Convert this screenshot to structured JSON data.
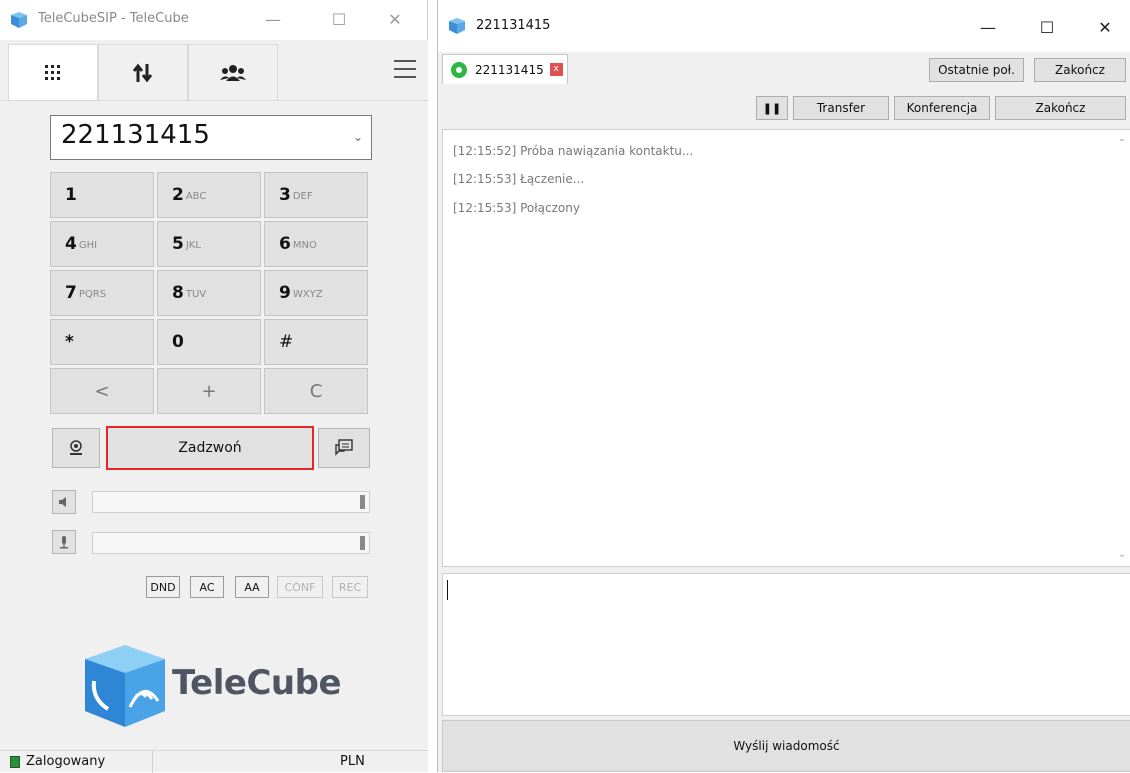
{
  "left_window": {
    "title": "TeleCubeSIP - TeleCube",
    "controls": {
      "minimize": "—",
      "maximize": "☐",
      "close": "✕"
    },
    "number": "221131415",
    "keypad": [
      {
        "digit": "1",
        "letters": ""
      },
      {
        "digit": "2",
        "letters": "ABC"
      },
      {
        "digit": "3",
        "letters": "DEF"
      },
      {
        "digit": "4",
        "letters": "GHI"
      },
      {
        "digit": "5",
        "letters": "JKL"
      },
      {
        "digit": "6",
        "letters": "MNO"
      },
      {
        "digit": "7",
        "letters": "PQRS"
      },
      {
        "digit": "8",
        "letters": "TUV"
      },
      {
        "digit": "9",
        "letters": "WXYZ"
      },
      {
        "digit": "*",
        "letters": ""
      },
      {
        "digit": "0",
        "letters": ""
      },
      {
        "digit": "#",
        "letters": ""
      }
    ],
    "bottom_keys": {
      "back": "<",
      "plus": "+",
      "clear": "C"
    },
    "call_label": "Zadzwoń",
    "flags": [
      {
        "label": "DND",
        "enabled": true
      },
      {
        "label": "AC",
        "enabled": true
      },
      {
        "label": "AA",
        "enabled": true
      },
      {
        "label": "CONF",
        "enabled": false
      },
      {
        "label": "REC",
        "enabled": false
      }
    ],
    "logo_text": "TeleCube",
    "status": {
      "text": "Zalogowany",
      "currency": "PLN",
      "led_color": "#2e8b3e"
    }
  },
  "right_window": {
    "title": "221131415",
    "controls": {
      "minimize": "—",
      "maximize": "☐",
      "close": "✕"
    },
    "call_tab": {
      "number": "221131415",
      "close": "x"
    },
    "top_buttons": {
      "recent": "Ostatnie poł.",
      "end": "Zakończ"
    },
    "call_buttons": {
      "hold": "❚❚",
      "transfer": "Transfer",
      "conference": "Konferencja",
      "end": "Zakończ"
    },
    "log": [
      "[12:15:52] Próba nawiązania kontaktu...",
      "[12:15:53] Łączenie...",
      "[12:15:53] Połączony"
    ],
    "send_label": "Wyślij wiadomość"
  },
  "colors": {
    "accent_red": "#e32626",
    "whatsapp_green": "#2bb741",
    "brand_blue": "#3a8fd8"
  }
}
